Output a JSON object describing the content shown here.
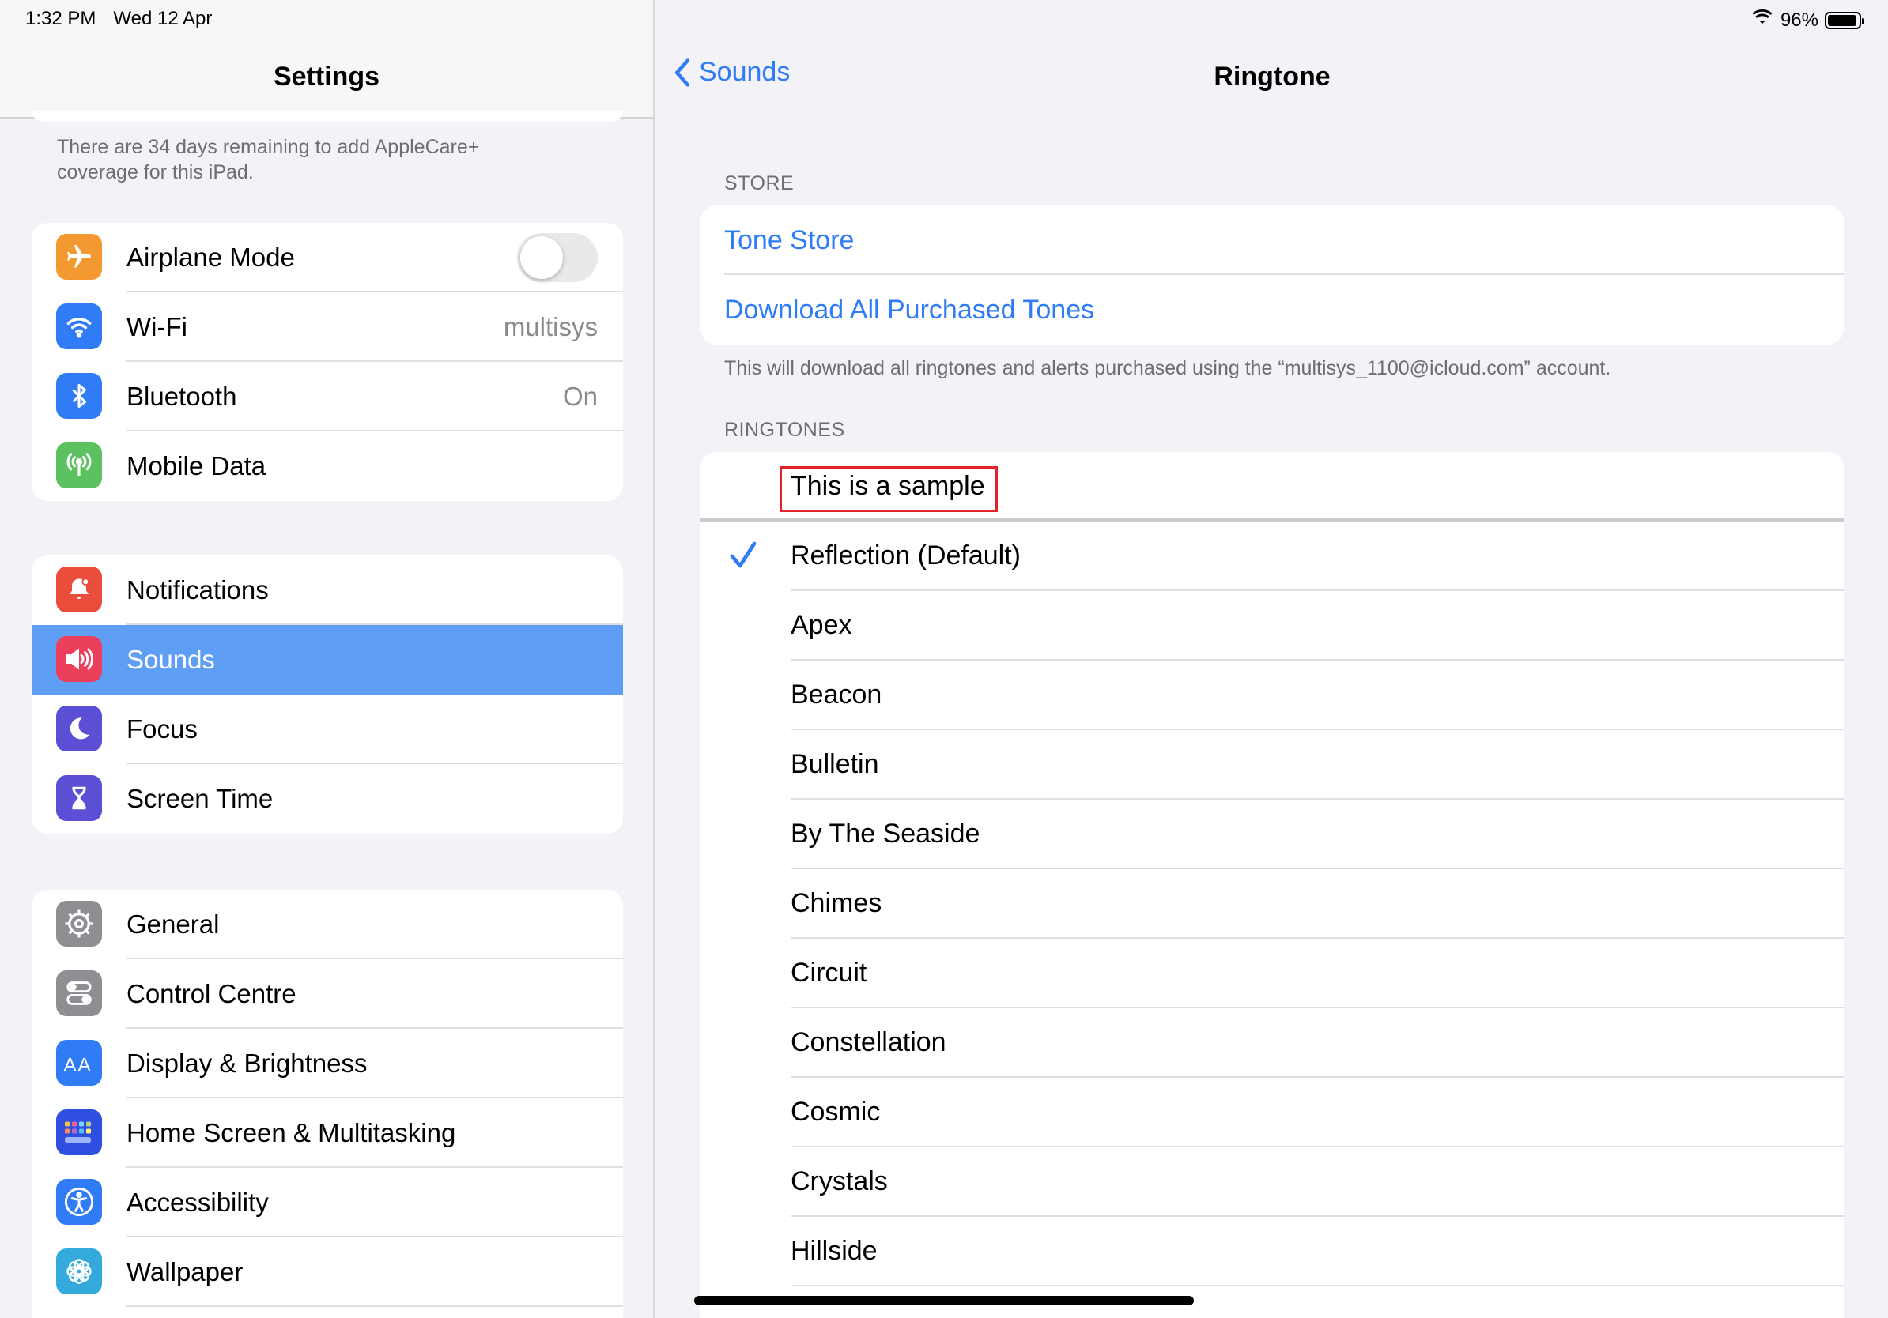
{
  "status_bar": {
    "time": "1:32 PM",
    "date": "Wed 12 Apr",
    "battery": "96%"
  },
  "settings": {
    "title": "Settings",
    "applecare_note": "There are 34 days remaining to add AppleCare+ coverage for this iPad.",
    "group1": [
      {
        "label": "Airplane Mode",
        "icon": "airplane-icon",
        "color": "#f3992f",
        "toggle": "off"
      },
      {
        "label": "Wi-Fi",
        "icon": "wifi-icon",
        "color": "#2f7cf6",
        "value": "multisys"
      },
      {
        "label": "Bluetooth",
        "icon": "bluetooth-icon",
        "color": "#2f7cf6",
        "value": "On"
      },
      {
        "label": "Mobile Data",
        "icon": "antenna-icon",
        "color": "#5cc15f"
      }
    ],
    "group2": [
      {
        "label": "Notifications",
        "icon": "bell-icon",
        "color": "#eb4d3d"
      },
      {
        "label": "Sounds",
        "icon": "speaker-icon",
        "color": "#eb3f5b",
        "selected": true
      },
      {
        "label": "Focus",
        "icon": "moon-icon",
        "color": "#5b4fd6"
      },
      {
        "label": "Screen Time",
        "icon": "hourglass-icon",
        "color": "#5b4fd6"
      }
    ],
    "group3": [
      {
        "label": "General",
        "icon": "gear-icon",
        "color": "#8e8e93"
      },
      {
        "label": "Control Centre",
        "icon": "switches-icon",
        "color": "#8e8e93"
      },
      {
        "label": "Display & Brightness",
        "icon": "text-size-icon",
        "color": "#2f7cf6"
      },
      {
        "label": "Home Screen & Multitasking",
        "icon": "grid-icon",
        "color": "#2e4fe0"
      },
      {
        "label": "Accessibility",
        "icon": "accessibility-icon",
        "color": "#2f7cf6"
      },
      {
        "label": "Wallpaper",
        "icon": "flower-icon",
        "color": "#34aadc"
      }
    ]
  },
  "ringtone_page": {
    "back_label": "Sounds",
    "title": "Ringtone",
    "store_header": "STORE",
    "store_items": [
      "Tone Store",
      "Download All Purchased Tones"
    ],
    "store_footer": "This will download all ringtones and alerts purchased using the “multisys_1100@icloud.com” account.",
    "ringtones_header": "RINGTONES",
    "sample_label": "This is a sample",
    "selected": "Reflection (Default)",
    "ringtones": [
      "Reflection (Default)",
      "Apex",
      "Beacon",
      "Bulletin",
      "By The Seaside",
      "Chimes",
      "Circuit",
      "Constellation",
      "Cosmic",
      "Crystals",
      "Hillside"
    ]
  },
  "colors": {
    "accent": "#2f7cf6",
    "selected_row": "#5f9ef5",
    "annotation": "#e0232a"
  }
}
